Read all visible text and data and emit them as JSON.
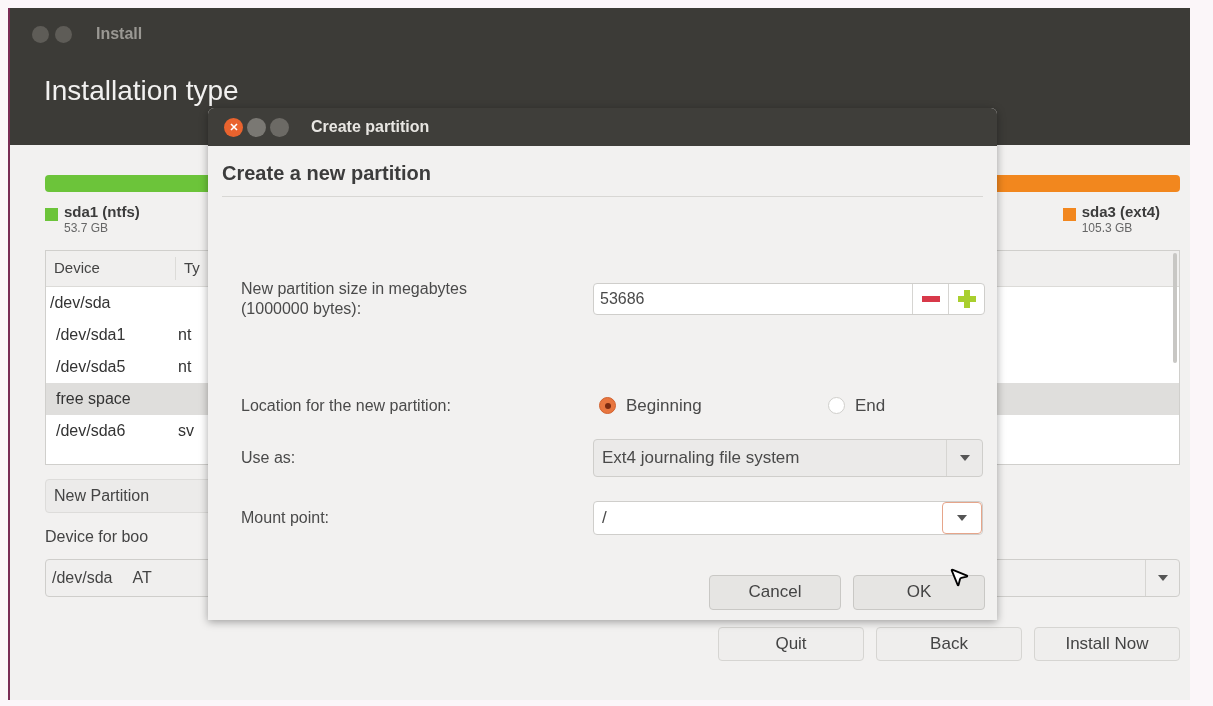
{
  "window": {
    "title": "Install",
    "heading": "Installation type"
  },
  "partition_bar": {
    "segments": [
      {
        "label": "sda1 (ntfs)",
        "size": "53.7 GB",
        "color": "#6cc43a"
      },
      {
        "label": "sda3 (ext4)",
        "size": "105.3 GB",
        "color": "#f2871e"
      }
    ]
  },
  "table": {
    "columns": [
      "Device",
      "Ty"
    ],
    "rows": [
      {
        "device": "/dev/sda",
        "selected": false,
        "children": [
          {
            "device": "/dev/sda1",
            "type": "nt",
            "selected": false
          },
          {
            "device": "/dev/sda5",
            "type": "nt",
            "selected": false
          },
          {
            "device": "free space",
            "selected": true
          },
          {
            "device": "/dev/sda6",
            "type": "sv",
            "selected": false
          }
        ]
      }
    ]
  },
  "new_partition_button": "New Partition",
  "boot_device": {
    "label": "Device for boo",
    "value": "/dev/sda",
    "value_2": "AT"
  },
  "buttons": [
    "Quit",
    "Back",
    "Install Now"
  ],
  "dialog": {
    "title": "Create partition",
    "heading": "Create a new partition",
    "size": {
      "label": "New partition size in megabytes (1000000 bytes):",
      "value": "53686"
    },
    "location": {
      "label": "Location for the new partition:",
      "options": [
        {
          "label": "Beginning",
          "selected": true
        },
        {
          "label": "End",
          "selected": false
        }
      ]
    },
    "use_as": {
      "label": "Use as:",
      "value": "Ext4 journaling file system"
    },
    "mount_point": {
      "label": "Mount point:",
      "value": "/"
    },
    "buttons": [
      "Cancel",
      "OK"
    ]
  }
}
